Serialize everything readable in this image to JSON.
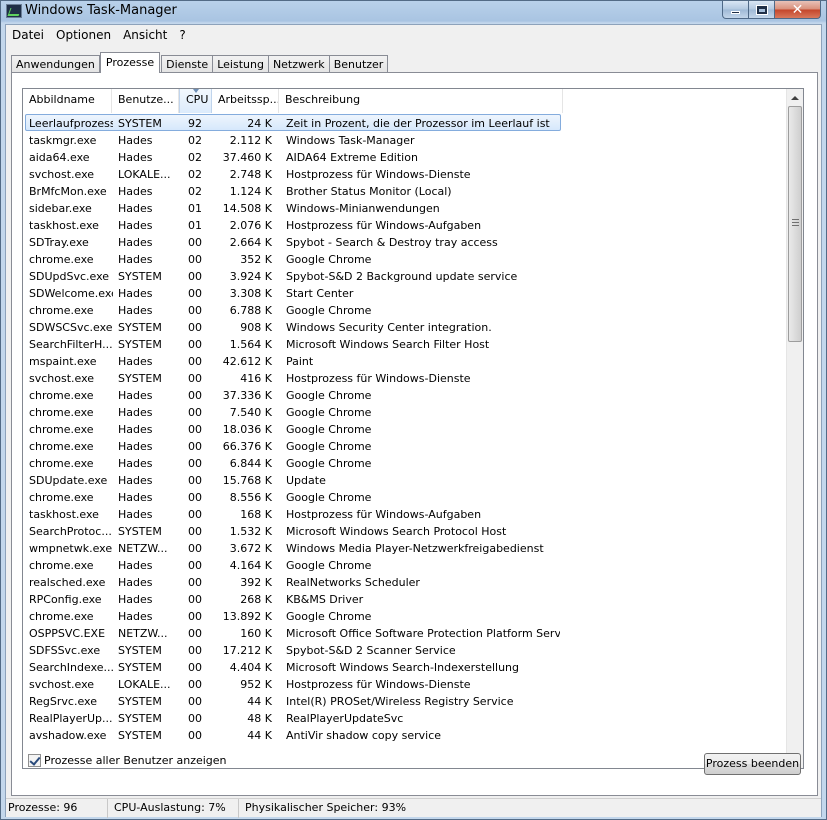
{
  "window": {
    "title": "Windows Task-Manager"
  },
  "menu": [
    "Datei",
    "Optionen",
    "Ansicht",
    "?"
  ],
  "tabs": [
    "Anwendungen",
    "Prozesse",
    "Dienste",
    "Leistung",
    "Netzwerk",
    "Benutzer"
  ],
  "active_tab": "Prozesse",
  "columns": [
    "Abbildname",
    "Benutze...",
    "CPU",
    "Arbeitssp...",
    "Beschreibung"
  ],
  "sorted_column": "CPU",
  "rows": [
    {
      "name": "Leerlaufprozess",
      "user": "SYSTEM",
      "cpu": "92",
      "mem": "24 K",
      "desc": "Zeit in Prozent, die der Prozessor im Leerlauf ist",
      "selected": true
    },
    {
      "name": "taskmgr.exe",
      "user": "Hades",
      "cpu": "02",
      "mem": "2.112 K",
      "desc": "Windows Task-Manager"
    },
    {
      "name": "aida64.exe",
      "user": "Hades",
      "cpu": "02",
      "mem": "37.460 K",
      "desc": "AIDA64 Extreme Edition"
    },
    {
      "name": "svchost.exe",
      "user": "LOKALE...",
      "cpu": "02",
      "mem": "2.748 K",
      "desc": "Hostprozess für Windows-Dienste"
    },
    {
      "name": "BrMfcMon.exe",
      "user": "Hades",
      "cpu": "02",
      "mem": "1.124 K",
      "desc": "Brother Status Monitor (Local)"
    },
    {
      "name": "sidebar.exe",
      "user": "Hades",
      "cpu": "01",
      "mem": "14.508 K",
      "desc": "Windows-Minianwendungen"
    },
    {
      "name": "taskhost.exe",
      "user": "Hades",
      "cpu": "01",
      "mem": "2.076 K",
      "desc": "Hostprozess für Windows-Aufgaben"
    },
    {
      "name": "SDTray.exe",
      "user": "Hades",
      "cpu": "00",
      "mem": "2.664 K",
      "desc": "Spybot - Search & Destroy tray access"
    },
    {
      "name": "chrome.exe",
      "user": "Hades",
      "cpu": "00",
      "mem": "352 K",
      "desc": "Google Chrome"
    },
    {
      "name": "SDUpdSvc.exe",
      "user": "SYSTEM",
      "cpu": "00",
      "mem": "3.924 K",
      "desc": "Spybot-S&D 2 Background update service"
    },
    {
      "name": "SDWelcome.exe",
      "user": "Hades",
      "cpu": "00",
      "mem": "3.308 K",
      "desc": "Start Center"
    },
    {
      "name": "chrome.exe",
      "user": "Hades",
      "cpu": "00",
      "mem": "6.788 K",
      "desc": "Google Chrome"
    },
    {
      "name": "SDWSCSvc.exe",
      "user": "SYSTEM",
      "cpu": "00",
      "mem": "908 K",
      "desc": "Windows Security Center integration."
    },
    {
      "name": "SearchFilterH...",
      "user": "SYSTEM",
      "cpu": "00",
      "mem": "1.564 K",
      "desc": "Microsoft Windows Search Filter Host"
    },
    {
      "name": "mspaint.exe",
      "user": "Hades",
      "cpu": "00",
      "mem": "42.612 K",
      "desc": "Paint"
    },
    {
      "name": "svchost.exe",
      "user": "SYSTEM",
      "cpu": "00",
      "mem": "416 K",
      "desc": "Hostprozess für Windows-Dienste"
    },
    {
      "name": "chrome.exe",
      "user": "Hades",
      "cpu": "00",
      "mem": "37.336 K",
      "desc": "Google Chrome"
    },
    {
      "name": "chrome.exe",
      "user": "Hades",
      "cpu": "00",
      "mem": "7.540 K",
      "desc": "Google Chrome"
    },
    {
      "name": "chrome.exe",
      "user": "Hades",
      "cpu": "00",
      "mem": "18.036 K",
      "desc": "Google Chrome"
    },
    {
      "name": "chrome.exe",
      "user": "Hades",
      "cpu": "00",
      "mem": "66.376 K",
      "desc": "Google Chrome"
    },
    {
      "name": "chrome.exe",
      "user": "Hades",
      "cpu": "00",
      "mem": "6.844 K",
      "desc": "Google Chrome"
    },
    {
      "name": "SDUpdate.exe",
      "user": "Hades",
      "cpu": "00",
      "mem": "15.768 K",
      "desc": "Update"
    },
    {
      "name": "chrome.exe",
      "user": "Hades",
      "cpu": "00",
      "mem": "8.556 K",
      "desc": "Google Chrome"
    },
    {
      "name": "taskhost.exe",
      "user": "Hades",
      "cpu": "00",
      "mem": "168 K",
      "desc": "Hostprozess für Windows-Aufgaben"
    },
    {
      "name": "SearchProtoc...",
      "user": "SYSTEM",
      "cpu": "00",
      "mem": "1.532 K",
      "desc": "Microsoft Windows Search Protocol Host"
    },
    {
      "name": "wmpnetwk.exe",
      "user": "NETZW...",
      "cpu": "00",
      "mem": "3.672 K",
      "desc": "Windows Media Player-Netzwerkfreigabedienst"
    },
    {
      "name": "chrome.exe",
      "user": "Hades",
      "cpu": "00",
      "mem": "4.164 K",
      "desc": "Google Chrome"
    },
    {
      "name": "realsched.exe",
      "user": "Hades",
      "cpu": "00",
      "mem": "392 K",
      "desc": "RealNetworks Scheduler"
    },
    {
      "name": "RPConfig.exe",
      "user": "Hades",
      "cpu": "00",
      "mem": "268 K",
      "desc": "KB&MS Driver"
    },
    {
      "name": "chrome.exe",
      "user": "Hades",
      "cpu": "00",
      "mem": "13.892 K",
      "desc": "Google Chrome"
    },
    {
      "name": "OSPPSVC.EXE",
      "user": "NETZW...",
      "cpu": "00",
      "mem": "160 K",
      "desc": "Microsoft Office Software Protection Platform Service"
    },
    {
      "name": "SDFSSvc.exe",
      "user": "SYSTEM",
      "cpu": "00",
      "mem": "17.212 K",
      "desc": "Spybot-S&D 2 Scanner Service"
    },
    {
      "name": "SearchIndexe...",
      "user": "SYSTEM",
      "cpu": "00",
      "mem": "4.404 K",
      "desc": "Microsoft Windows Search-Indexerstellung"
    },
    {
      "name": "svchost.exe",
      "user": "LOKALE...",
      "cpu": "00",
      "mem": "952 K",
      "desc": "Hostprozess für Windows-Dienste"
    },
    {
      "name": "RegSrvc.exe",
      "user": "SYSTEM",
      "cpu": "00",
      "mem": "44 K",
      "desc": "Intel(R) PROSet/Wireless Registry Service"
    },
    {
      "name": "RealPlayerUp...",
      "user": "SYSTEM",
      "cpu": "00",
      "mem": "48 K",
      "desc": "RealPlayerUpdateSvc"
    },
    {
      "name": "avshadow.exe",
      "user": "SYSTEM",
      "cpu": "00",
      "mem": "44 K",
      "desc": "AntiVir shadow copy service"
    }
  ],
  "show_all_users": {
    "label": "Prozesse aller Benutzer anzeigen",
    "checked": true
  },
  "end_process_label": "Prozess beenden",
  "status": {
    "processes": "Prozesse: 96",
    "cpu": "CPU-Auslastung: 7%",
    "memory": "Physikalischer Speicher: 93%"
  }
}
